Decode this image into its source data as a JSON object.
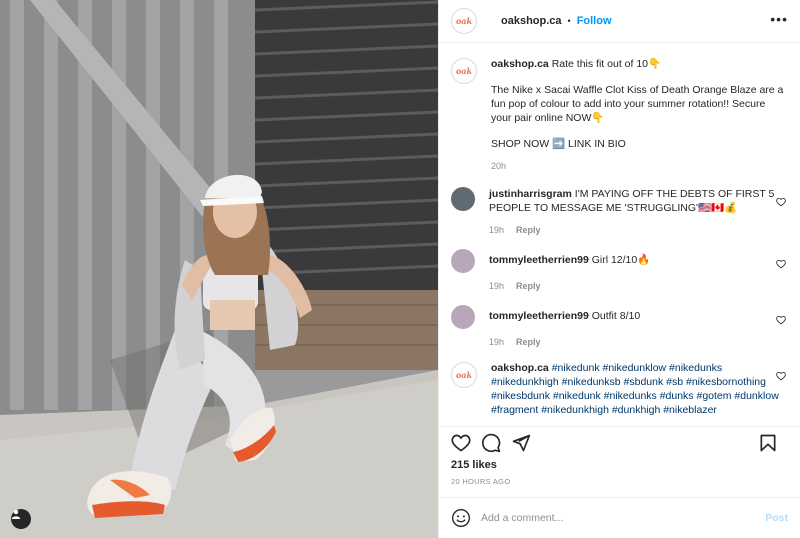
{
  "post": {
    "author": "oakshop.ca",
    "follow_label": "Follow",
    "header_dot": "•",
    "avatar_text": "oak",
    "caption_line1": "Rate this fit out of 10👇",
    "caption_line2": "The Nike x Sacai Waffle Clot Kiss of Death Orange Blaze are a fun pop of colour to add into your summer rotation!! Secure your pair online NOW👇",
    "caption_line3": "SHOP NOW ➡️ LINK IN BIO",
    "caption_time": "20h"
  },
  "comments": [
    {
      "user": "justinharrisgram",
      "text": "I'M PAYING OFF THE DEBTS OF FIRST 5 PEOPLE TO MESSAGE ME 'STRUGGLING'🇺🇸🇨🇦💰",
      "time": "19h",
      "reply": "Reply"
    },
    {
      "user": "tommyleetherrien99",
      "text": "Girl 12/10🔥",
      "time": "19h",
      "reply": "Reply"
    },
    {
      "user": "tommyleetherrien99",
      "text": "Outfit 8/10",
      "time": "19h",
      "reply": "Reply"
    },
    {
      "user": "oakshop.ca",
      "text": "#nikedunk #nikedunklow #nikedunks #nikedunkhigh #nikedunksb #sbdunk #sb #nikesbornothing #nikesbdunk #nikedunk #nikedunks #dunks #gotem #dunklow #fragment #nikedunkhigh #dunkhigh #nikeblazer"
    }
  ],
  "stats": {
    "likes": "215 likes",
    "posted": "20 HOURS AGO"
  },
  "composer": {
    "placeholder": "Add a comment...",
    "post_label": "Post"
  },
  "colors": {
    "accent": "#0095f6",
    "brand": "#e8734a",
    "muted": "#8e8e8e"
  }
}
